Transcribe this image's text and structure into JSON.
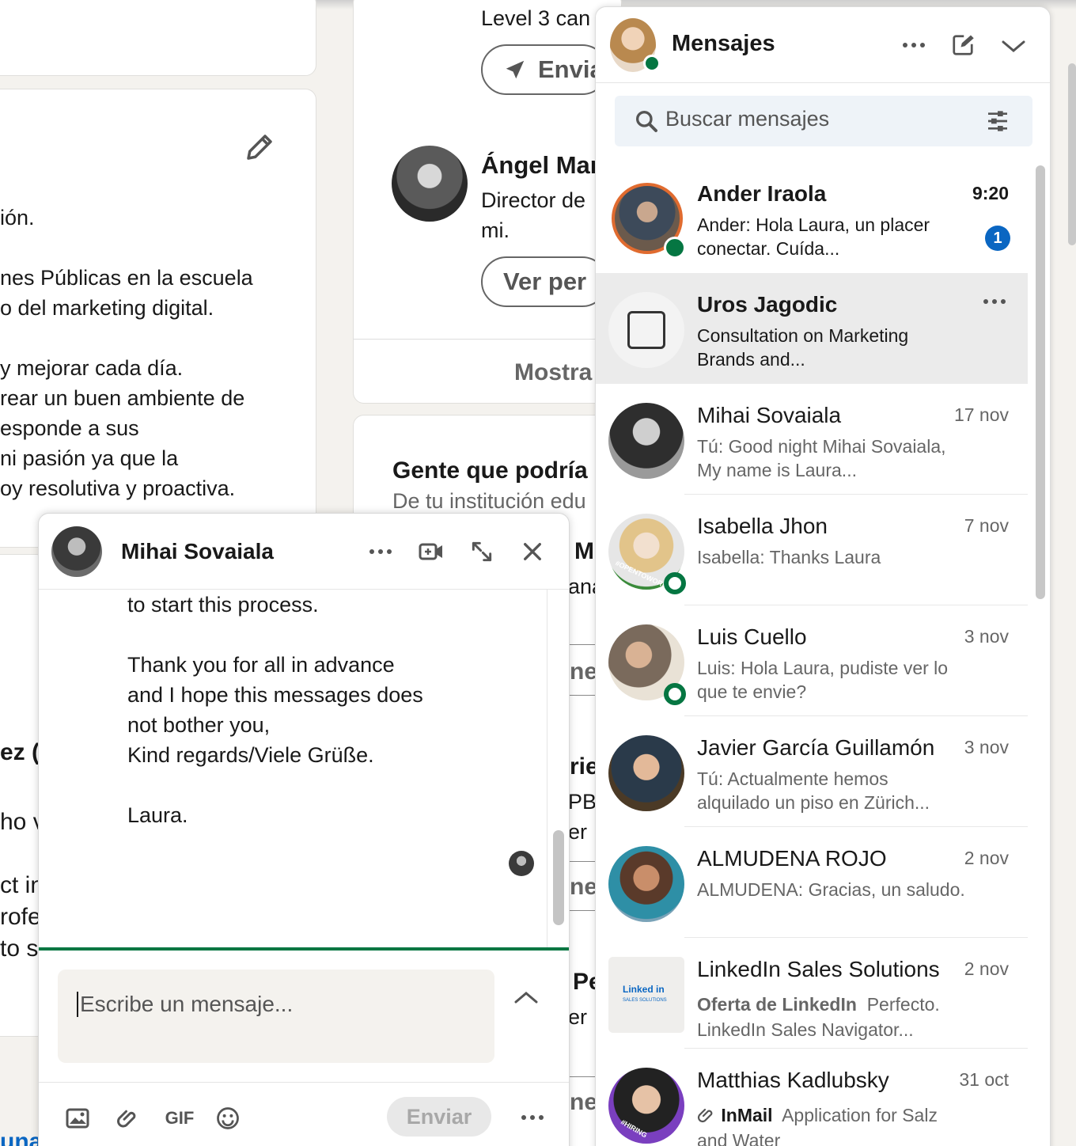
{
  "background": {
    "profile_text": [
      "ión.",
      "nes Públicas en la escuela",
      "o del marketing digital.",
      "y mejorar cada día.",
      "rear un buen ambiente de",
      "esponde a sus",
      "ni pasión ya que la",
      "oy resolutiva y proactiva."
    ],
    "left_partials": [
      "ez (",
      "ho v",
      "ct in",
      "rofe",
      "to s",
      "una"
    ],
    "center": {
      "level_text": "Level 3 can",
      "send_button": "Envia",
      "person_name": "Ángel Mar",
      "person_title": "Director de",
      "person_title2": "mi.",
      "view_button": "Ver per",
      "show_more": "Mostra",
      "people_heading": "Gente que podría",
      "people_sub": "De tu institución edu"
    },
    "center_partials": [
      "M",
      "ana",
      "ne",
      "rie",
      "PB",
      "er",
      "ne",
      "Pe",
      "er",
      "ne"
    ]
  },
  "messaging": {
    "title": "Mensajes",
    "search_placeholder": "Buscar mensajes",
    "conversations": [
      {
        "name": "Ander Iraola",
        "date": "9:20",
        "snippet": "Ander: Hola Laura, un placer conectar. Cuída...",
        "unread": "1"
      },
      {
        "name": "Uros Jagodic",
        "date": "",
        "snippet": "Consultation on Marketing Brands and..."
      },
      {
        "name": "Mihai Sovaiala",
        "date": "17 nov",
        "snippet": "Tú: Good night Mihai Sovaiala,  My name is Laura..."
      },
      {
        "name": "Isabella Jhon",
        "date": "7 nov",
        "snippet": "Isabella: Thanks Laura"
      },
      {
        "name": "Luis Cuello",
        "date": "3 nov",
        "snippet": "Luis: Hola Laura, pudiste ver lo que te envie?"
      },
      {
        "name": "Javier García Guillamón",
        "date": "3 nov",
        "snippet": "Tú: Actualmente hemos alquilado un piso en Zürich..."
      },
      {
        "name": "ALMUDENA ROJO",
        "date": "2 nov",
        "snippet": "ALMUDENA: Gracias, un saludo."
      },
      {
        "name": "LinkedIn Sales Solutions",
        "date": "2 nov",
        "tag": "Oferta de LinkedIn",
        "snippet": "Perfecto. LinkedIn Sales Navigator..."
      },
      {
        "name": "Matthias Kadlubsky",
        "date": "31 oct",
        "tag": "InMail",
        "snippet": "Application for Salz and Water"
      }
    ],
    "linkedin_logo": "Linked in",
    "linkedin_logo_sub": "SALES SOLUTIONS",
    "opentowork": "#OPENTOWORK",
    "hiring": "#HIRING"
  },
  "chat": {
    "name": "Mihai Sovaiala",
    "message": "to start this process.\n\nThank you for all in advance\nand I hope this messages does\nnot bother you,\nKind regards/Viele Grüße.\n\nLaura.",
    "composer_placeholder": "Escribe un mensaje...",
    "send_label": "Enviar",
    "gif_label": "GIF"
  },
  "colors": {
    "brand_blue": "#0a66c2",
    "presence_green": "#057642",
    "page_bg": "#f4f2ee"
  }
}
